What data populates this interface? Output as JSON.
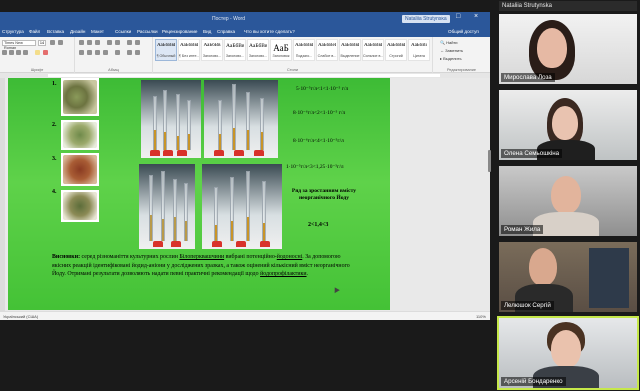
{
  "word": {
    "title_center": "Постер  -  Word",
    "user_name": "Nataliia Strutynska",
    "quick_access": "Структура",
    "tabs": [
      "Структура",
      "Файл",
      "Вставка",
      "Дизайн",
      "Макет",
      "Ссылки",
      "Рассылки",
      "Рецензирование",
      "Вид",
      "Справка",
      "Что вы хотите сделать?"
    ],
    "share": "Общий доступ",
    "font_name": "Times New Roman",
    "font_size": "14",
    "group_labels": [
      "Шрифт",
      "Абзац",
      "Стили",
      "Редактирование"
    ],
    "styles": [
      {
        "preview": "АаБбВвГг",
        "name": "¶ Обычный",
        "selected": true
      },
      {
        "preview": "АаБбВвГг",
        "name": "¶ Без инте...",
        "selected": false
      },
      {
        "preview": "АаБбВв",
        "name": "Заголово...",
        "selected": false
      },
      {
        "preview": "АаБбВвГ",
        "name": "Заголово...",
        "selected": false
      },
      {
        "preview": "АаБбВвГ",
        "name": "Заголово...",
        "selected": false
      },
      {
        "preview": "АаБ",
        "name": "Заголовок",
        "selected": false
      },
      {
        "preview": "АаБбВвГ",
        "name": "Подзаго...",
        "selected": false
      },
      {
        "preview": "АаБбВеГ",
        "name": "Слабое в...",
        "selected": false
      },
      {
        "preview": "АаБбВвГг",
        "name": "Выделение",
        "selected": false
      },
      {
        "preview": "АаБбВвГ",
        "name": "Сильное в...",
        "selected": false
      },
      {
        "preview": "АаБбВвГг",
        "name": "Строгий",
        "selected": false
      },
      {
        "preview": "АаБбВі",
        "name": "Цитата",
        "selected": false
      }
    ],
    "editing": [
      "Найти",
      "Заменить",
      "Выделить"
    ],
    "status_left": "Український (США)",
    "zoom": "110%"
  },
  "slide": {
    "numbers": [
      "1.",
      "2.",
      "3.",
      "4."
    ],
    "formulas": [
      "5·10⁻⁵г/л<1<1·10⁻⁵ г/л",
      "8·10⁻⁶г/л<2<1·10⁻⁵ г/л",
      "8·10⁻⁶г/л<4<1·10⁻⁵г/л",
      "1·10⁻⁵г/л<3<1,25·10⁻⁵г/л"
    ],
    "row_title": "Ряд за зростанням вмісту неорганічного Йоду",
    "series": "2<1,4<3",
    "conclusion_label": "Висновки:",
    "conclusion_parts": [
      " серед різноманіття культурних рослин ",
      "Білоперквашчини",
      " вибрані потенційно-",
      "йодоносні",
      ". За допомогою якісних реакцій ідентифіковані йодид-аніони у досліджених зразках, а також оцінений кількісний вміст неорганічного Йоду. Отримані результати дозволяють надати певні практичні рекомендації щодо ",
      "йодопрофілактики",
      "."
    ]
  },
  "participants": [
    {
      "name": "Мирослава Лоза"
    },
    {
      "name": "Олена Семьошкіна"
    },
    {
      "name": "Роман Жила"
    },
    {
      "name": "Лелюшок Сергій"
    },
    {
      "name": "Арсеній Бондаренко"
    }
  ],
  "colors": {
    "word_blue": "#2b579a",
    "slide_green": "#4cc43c",
    "active_speaker": "#c6e84a"
  }
}
